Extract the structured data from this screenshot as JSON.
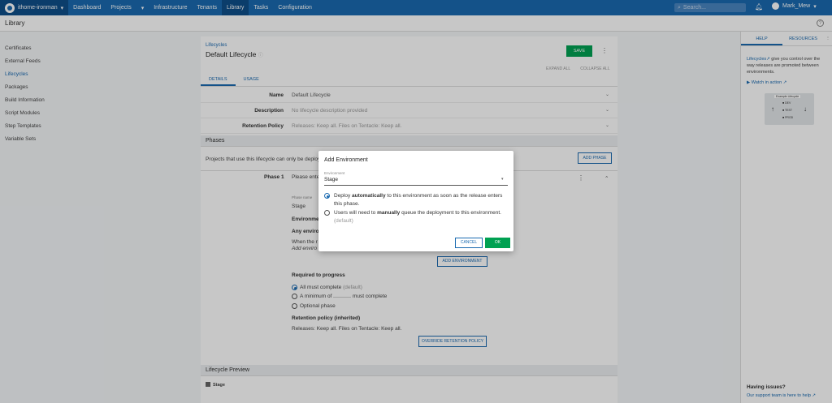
{
  "topnav": {
    "space": "ithome-ironman",
    "items": [
      "Dashboard",
      "Projects",
      "Infrastructure",
      "Tenants",
      "Library",
      "Tasks",
      "Configuration"
    ],
    "active": "Library",
    "search_placeholder": "Search...",
    "user": "Mark_Mew"
  },
  "page": {
    "title": "Library"
  },
  "sidebar": {
    "items": [
      "Certificates",
      "External Feeds",
      "Lifecycles",
      "Packages",
      "Build Information",
      "Script Modules",
      "Step Templates",
      "Variable Sets"
    ],
    "active": "Lifecycles"
  },
  "main": {
    "breadcrumb": "Lifecycles",
    "title": "Default Lifecycle",
    "save_label": "SAVE",
    "expand_all": "EXPAND ALL",
    "collapse_all": "COLLAPSE ALL",
    "tabs": [
      "DETAILS",
      "USAGE"
    ],
    "rows": [
      {
        "label": "Name",
        "value": "Default Lifecycle"
      },
      {
        "label": "Description",
        "value": "No lifecycle description provided"
      },
      {
        "label": "Retention Policy",
        "value": "Releases: Keep all. Files on Tentacle: Keep all."
      }
    ],
    "phases_head": "Phases",
    "phases_text": "Projects that use this lifecycle can only be deployed",
    "add_phase": "ADD PHASE",
    "phase_label": "Phase 1",
    "phase_text": "Please enter",
    "phase_name_label": "Phase name",
    "phase_name_value": "Stage",
    "environments": "Environment",
    "any_env": "Any environ",
    "when_text": "When the r",
    "add_env_text": "Add enviro",
    "add_environment": "ADD ENVIRONMENT",
    "required_head": "Required to progress",
    "opt_all": "All must complete",
    "opt_all_default": "(default)",
    "opt_min_a": "A minimum of",
    "opt_min_b": "must complete",
    "opt_optional": "Optional phase",
    "retention_head": "Retention policy (inherited)",
    "retention_text": "Releases: Keep all. Files on Tentacle: Keep all.",
    "override": "OVERRIDE RETENTION POLICY",
    "preview_head": "Lifecycle Preview",
    "preview_item": "Stage"
  },
  "right_panel": {
    "tabs": [
      "HELP",
      "RESOURCES"
    ],
    "help_link": "Lifecycles",
    "help_text": " give you control over the way releases are promoted between environments.",
    "watch": "Watch in action",
    "diagram_title": "Example Lifecycle",
    "diagram_items": [
      "DEV",
      "TEST",
      "PROD"
    ],
    "issues_head": "Having issues?",
    "issues_text": "Our support team is here to help"
  },
  "dialog": {
    "title": "Add Environment",
    "field_label": "Environment",
    "field_value": "Stage",
    "opt1_a": "Deploy ",
    "opt1_b": "automatically",
    "opt1_c": " to this environment as soon as the release enters this phase.",
    "opt2_a": "Users will need to ",
    "opt2_b": "manually",
    "opt2_c": " queue the deployment to this environment.",
    "opt2_default": "(default)",
    "cancel": "CANCEL",
    "ok": "OK"
  },
  "colors": {
    "nav": "#1a6ab0",
    "accent": "#00a152"
  }
}
